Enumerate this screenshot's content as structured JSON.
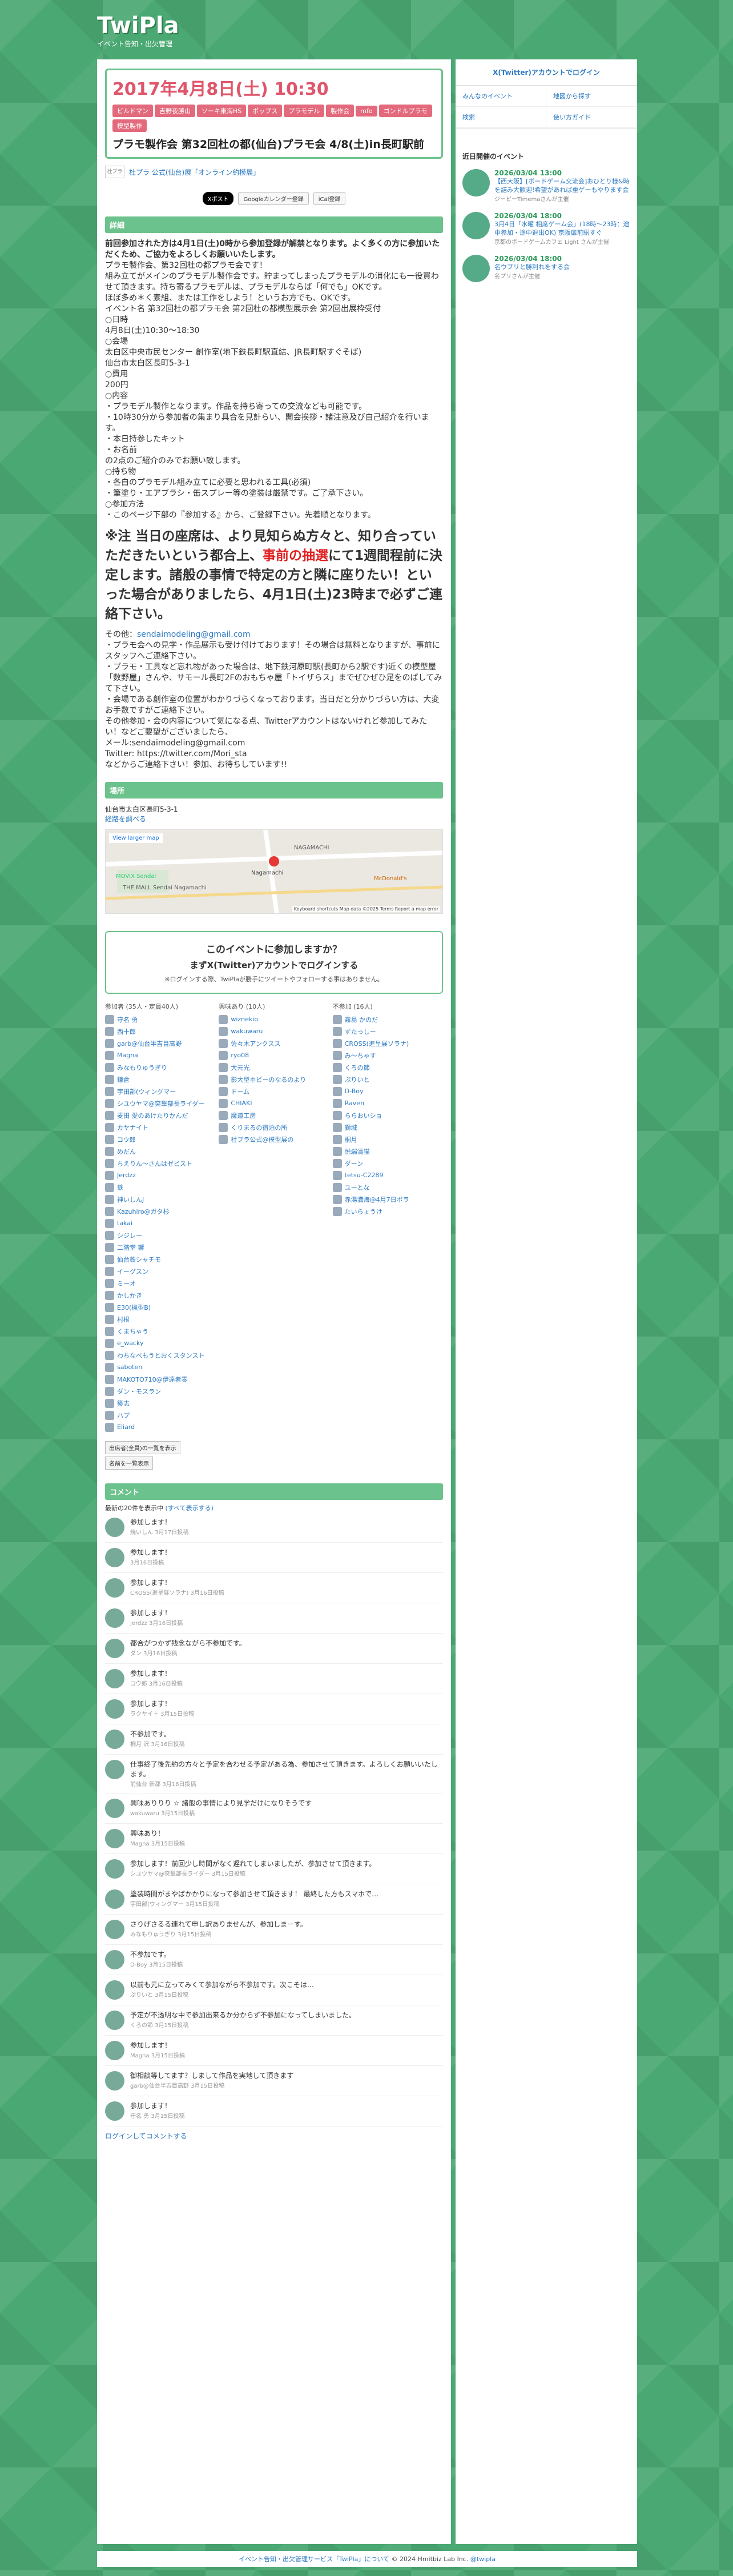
{
  "site": {
    "logo": "TwiPla",
    "tagline": "イベント告知・出欠管理"
  },
  "event": {
    "date": "2017年4月8日(土) 10:30",
    "tags": [
      "ビルドマン",
      "吉野夜勝山",
      "ソーキ東海HS",
      "ポップス",
      "プラモデル",
      "製作会",
      "mfo",
      "ゴンドルプラモ",
      "模型製作"
    ],
    "title": "プラモ製作会 第32回杜の都(仙台)プラモ会 4/8(土)in長町駅前",
    "organizer": "杜プラ 公式(仙台)展「オンライン約模展」",
    "organizer_logo": "杜プラ",
    "share": [
      "Xポスト",
      "Googleカレンダー登録",
      "iCal登録"
    ]
  },
  "detail": {
    "heading": "詳細",
    "intro": "前回参加された方は4月1日(土)0時から参加登録が解禁となります。よく多くの方に参加いただくため、ご協力をよろしくお願いいたします。",
    "lines": [
      "プラモ製作会、第32回杜の都プラモ会です！",
      "組み立てがメインのプラモデル製作会です。貯まってしまったプラモデルの消化にも一役買わせて頂きます。持ち寄るプラモデルは、プラモデルならば「何でも」OKです。",
      "ほぼ多め＊く素組、または工作をしよう！というお方でも、OKです。",
      "イベント名 第32回杜の都プラモ会 第2回杜の都模型展示会 第2回出展枠受付",
      "○日時",
      "4月8日(土)10:30〜18:30",
      "○会場",
      "太白区中央市民センター 創作室(地下鉄長町駅直結、JR長町駅すぐそば)",
      "仙台市太白区長町5-3-1",
      "○費用",
      "200円",
      "○内容",
      "・プラモデル製作となります。作品を持ち寄っての交流なども可能です。",
      "・10時30分から参加者の集まり具合を見計らい、開会挨拶・諸注意及び自己紹介を行います。",
      "・本日持参したキット",
      "・お名前",
      "の2点のご紹介のみでお願い致します。",
      "○持ち物",
      "・各自のプラモデル組み立てに必要と思われる工具(必須)",
      "・筆塗り・エアブラシ・缶スプレー等の塗装は厳禁です。ご了承下さい。",
      "○参加方法",
      "・このページ下部の『参加する』から、ご登録下さい。先着順となります。"
    ],
    "notice_1": "※注 当日の座席は、より見知らぬ方々と、知り合っていただきたいという都合上、",
    "notice_red": "事前の抽選",
    "notice_2": "にて1週間程前に決定します。諸般の事情で特定の方と隣に座りたい！といった場合がありましたら、4月1日(土)23時まで必ずご連絡下さい。",
    "contact_label": "その他：",
    "contact_email": "sendaimodeling@gmail.com",
    "lines_after": [
      "・プラモ会への見学・作品展示も受け付けております！その場合は無料となりますが、事前にスタッフへご連絡下さい。",
      "・プラモ・工具など忘れ物があった場合は、地下鉄河原町駅(長町から2駅です)近くの模型屋「数野屋」さんや、サモール長町2Fのおもちゃ屋「トイザらス」までぜひぜひ足をのばしてみて下さい。",
      "・会場である創作室の位置がわかりづらくなっております。当日だと分かりづらい方は、大変お手数ですがご連絡下さい。",
      "その他参加・会の内容について気になる点、Twitterアカウントはないけれど参加してみたい！などご要望がございましたら、",
      "メール:sendaimodeling@gmail.com",
      "Twitter: https://twitter.com/Mori_sta",
      "などからご連絡下さい！参加、お待ちしています!!"
    ]
  },
  "location": {
    "heading": "場所",
    "address": "仙台市太白区長町5-3-1",
    "route_link": "経路を調べる",
    "map_larger": "View larger map",
    "map_labels": [
      "NAGAMACHI",
      "MOVIX Sendai",
      "THE MALL Sendai Nagamachi",
      "McDonald's",
      "Nagamachi",
      "Map data ©2025",
      "Terms",
      "Report a map error",
      "Keyboard shortcuts"
    ]
  },
  "join": {
    "title": "このイベントに参加しますか？",
    "prompt": "まずX(Twitter)アカウントでログインする",
    "sub": "※ログインする際、TwiPlaが勝手にツイートやフォローする事はありません。"
  },
  "participants": {
    "attending_label": "参加者 (35人・定員40人)",
    "maybe_label": "興味あり (10人)",
    "absent_label": "不参加 (16人)",
    "attending": [
      "守名 勇",
      "西十郎",
      "garb@仙台半吉目高野",
      "Magna",
      "みなもりゅうぎり",
      "鎌倉",
      "宇田部(ウィングマー",
      "シユウヤマ@突撃部長ライダー",
      "麦田 愛のあけたりかんだ",
      "カヤナイト",
      "コウ郎",
      "めだん",
      "ちえりん〜さんはゼビスト",
      "Jerdzz",
      "鉄",
      "神いしんJ",
      "Kazuhiro@ガタ杉",
      "takai",
      "シジレー",
      "二階堂 響",
      "仙台鉄シャチモ",
      "イーグスン",
      "ミーオ",
      "かしかき",
      "E30(機型B)",
      "村根",
      "くまちゃう",
      "e_wacky",
      "わちなべもうとおくスタンスト",
      "saboten",
      "MAKOTO710@伊達者零",
      "ダン・モスラン",
      "築志",
      "ハプ",
      "Eliard"
    ],
    "maybe": [
      "wiznekio",
      "wakuwaru",
      "佐々木アンクスス",
      "ryo08",
      "大元光",
      "影大型ホビーのなるのより",
      "ドーム",
      "CHIAKI",
      "魔道工房",
      "くりまるの宿泊の所",
      "社プラ公式@模型展の"
    ],
    "absent": [
      "霧島 かのだ",
      "ずたっしー",
      "CROSS(進呈展ソラナ)",
      "み〜ちゃす",
      "くろの節",
      "ぷりいと",
      "D-Boy",
      "Raven",
      "ららおいショ",
      "獅城",
      "桐月",
      "悦端清猫",
      "ダーン",
      "tetsu-C2289",
      "ユーとな",
      "赤湯満海@4月7日ボラ",
      "たいらょうけ"
    ],
    "btn_all": "出席者(全員)の一覧を表示",
    "btn_csv": "名前を一覧表示"
  },
  "comments": {
    "heading": "コメント",
    "showing": "最新の20件を表示中",
    "show_all": "(すべて表示する)",
    "items": [
      {
        "text": "参加します！",
        "meta": "焼いしん  3月17日投稿"
      },
      {
        "text": "参加します！",
        "meta": "3月16日投稿"
      },
      {
        "text": "参加します！",
        "meta": "CROSS(進呈展ソラナ)  3月16日投稿"
      },
      {
        "text": "参加します！",
        "meta": "Jerdzz  3月16日投稿"
      },
      {
        "text": "都合がつかず残念ながら不参加です。",
        "meta": "ダン  3月16日投稿"
      },
      {
        "text": "参加します！",
        "meta": "コウ郎  3月16日投稿"
      },
      {
        "text": "参加します！",
        "meta": "ラクヤイト  3月15日投稿"
      },
      {
        "text": "不参加です。",
        "meta": "桐月 沢  3月16日投稿"
      },
      {
        "text": "仕事終了後先約の方々と予定を合わせる予定がある為、参加させて頂きます。よろしくお願いいたします。",
        "meta": "前仙台 新都  3月16日投稿"
      },
      {
        "text": "興味ありりり ☆ 諸般の事情により見学だけになりそうです",
        "meta": "wakuwaru  3月15日投稿"
      },
      {
        "text": "興味あり！",
        "meta": "Magna  3月15日投稿"
      },
      {
        "text": "参加します！前回少し時間がなく遅れてしまいましたが、参加させて頂きます。",
        "meta": "シユウヤマ@突撃部長ライダー  3月15日投稿"
      },
      {
        "text": "塗装時間がまやばかかりになって参加させて頂きます！ 最終した方もスマホで…",
        "meta": "宇田部(ウィングマー  3月15日投稿"
      },
      {
        "text": "さりげさるる連れて申し訳ありませんが、参加しまーす。",
        "meta": "みなもりゅうぎり  3月15日投稿"
      },
      {
        "text": "不参加です。",
        "meta": "D-Boy  3月15日投稿"
      },
      {
        "text": "以前も元に立ってみくて参加ながら不参加です。次こそは…",
        "meta": "ぷりいと  3月15日投稿"
      },
      {
        "text": "予定が不透明な中で参加出来るか分からず不参加になってしまいました。",
        "meta": "くろの節  3月15日投稿"
      },
      {
        "text": "参加します！",
        "meta": "Magna  3月15日投稿"
      },
      {
        "text": "御相談等してます？しまして作品を実地して頂きます",
        "meta": "garb@仙台半吉目高野  3月15日投稿"
      },
      {
        "text": "参加します！",
        "meta": "守名 勇  3月15日投稿"
      }
    ],
    "login_link": "ログインしてコメントする"
  },
  "sidebar": {
    "login": "X(Twitter)アカウントでログイン",
    "nav": [
      "みんなのイベント",
      "地図から探す",
      "検索",
      "使い方ガイド"
    ],
    "recent_heading": "近日開催のイベント",
    "recent": [
      {
        "date": "2026/03/04 13:00",
        "title": "【西大阪】[ボードゲーム交流会]おひとり様&時を詰み大歓迎!希望があれば重ゲーもやります会",
        "by": "ジーピーTimemaさんが主催"
      },
      {
        "date": "2026/03/04 18:00",
        "title": "3月4日「水曜 相席ゲーム会」(18時〜23時：途中参加・途中退出OK) 京阪扉前駅すぐ",
        "by": "京都のボードゲームカフェ Light さんが主催"
      },
      {
        "date": "2026/03/04 18:00",
        "title": "名ウプリと勝利れをする会",
        "by": "名プリさんが主催"
      }
    ]
  },
  "footer": {
    "text": "イベント告知・出欠管理サービス「TwiPla」について",
    "copy": "© 2024 Hmitbiz Lab Inc.",
    "tw": "@twipla"
  },
  "colors": {
    "accent": "#6cc28c",
    "date": "#e0556a",
    "tag": "#e36a7c",
    "link": "#2b79c2"
  }
}
